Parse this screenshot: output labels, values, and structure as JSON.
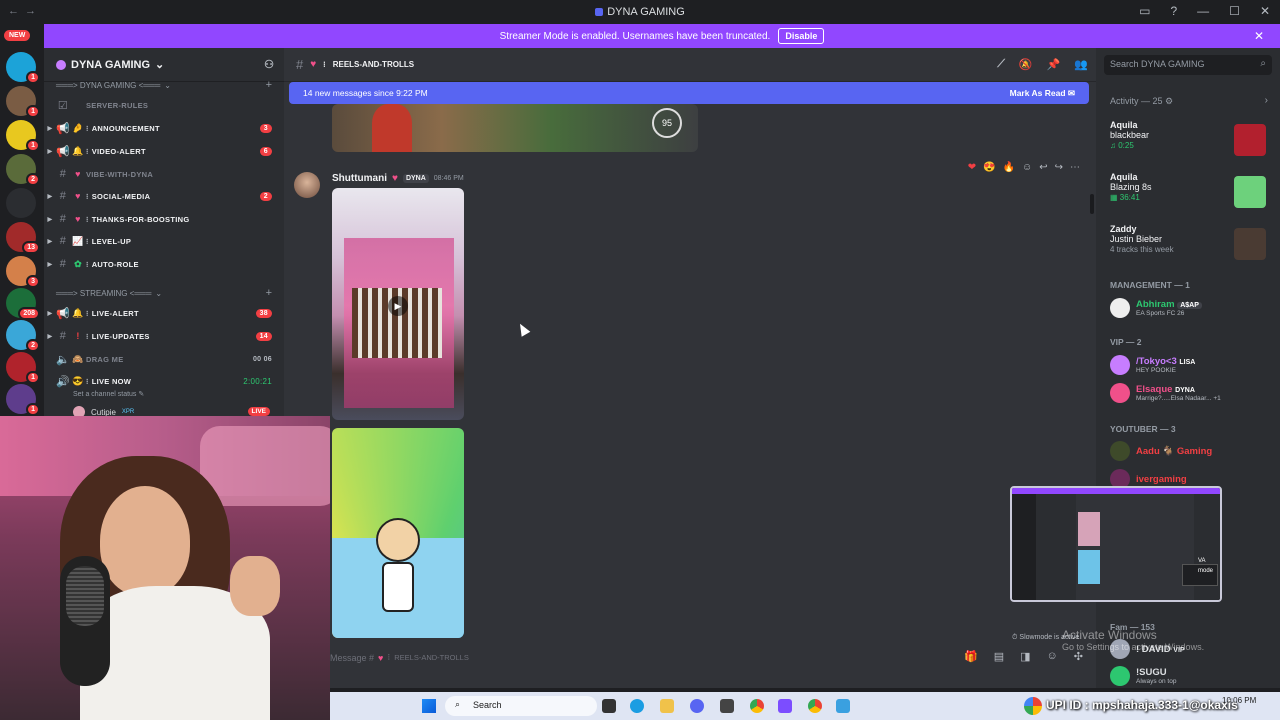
{
  "window": {
    "title": "DYNA GAMING"
  },
  "banner": {
    "text": "Streamer Mode is enabled. Usernames have been truncated.",
    "button": "Disable",
    "color": "#9147ff"
  },
  "rail": {
    "new_label": "NEW",
    "badges": [
      "1",
      "1",
      "1",
      "2",
      "13",
      "3",
      "208",
      "2",
      "1",
      "1"
    ]
  },
  "server": {
    "name": "DYNA GAMING",
    "category1": "═══> DYNA GAMING <═══",
    "category2": "═══> STREAMING <═══",
    "channels": [
      {
        "name": "SERVER-RULES",
        "muted": true
      },
      {
        "name": "ANNOUNCEMENT",
        "count": "3"
      },
      {
        "name": "VIDEO-ALERT",
        "count": "6"
      },
      {
        "name": "VIBE-WITH-DYNA",
        "muted": true
      },
      {
        "name": "SOCIAL-MEDIA",
        "count": "2"
      },
      {
        "name": "THANKS-FOR-BOOSTING"
      },
      {
        "name": "LEVEL-UP"
      },
      {
        "name": "AUTO-ROLE"
      }
    ],
    "stream_channels": [
      {
        "name": "LIVE-ALERT",
        "count": "38"
      },
      {
        "name": "LIVE-UPDATES",
        "count": "14"
      },
      {
        "name": "DRAG ME",
        "extra": "00  06",
        "muted": true
      },
      {
        "name": "LIVE NOW",
        "extra": "2:00:21"
      }
    ],
    "channel_status": "Set a channel status",
    "voice_user": "Cutipie",
    "voice_user_tag": "XPR",
    "live_badge": "LIVE"
  },
  "chat": {
    "channel": "REELS-AND-TROLLS",
    "new_messages": "14 new messages since 9:22 PM",
    "mark_as_read": "Mark As Read",
    "speed": "95",
    "author": "Shuttumani",
    "author_tag": "DYNA",
    "timestamp": "08:46 PM",
    "composer_placeholder": "Message #",
    "composer_channel": "REELS-AND-TROLLS",
    "slowmode": "Slowmode is active"
  },
  "members": {
    "search_placeholder": "Search DYNA GAMING",
    "activity_header": "Activity — 25",
    "activities": [
      {
        "name": "Aquila",
        "title": "blackbear",
        "detail": "0:25"
      },
      {
        "name": "Aquila",
        "title": "Blazing 8s",
        "detail": "36:41"
      },
      {
        "name": "Zaddy",
        "title": "Justin Bieber",
        "detail": "4 tracks this week"
      }
    ],
    "management_header": "MANAGEMENT — 1",
    "management": [
      {
        "name": "Abhiram",
        "tag": "A$AP",
        "status": "EA Sports FC 26",
        "color": "#2dc770"
      }
    ],
    "vip_header": "VIP — 2",
    "vip": [
      {
        "name": "/Tokyo<3",
        "tag": "LISA",
        "status": "HEY POOKIE",
        "color": "#c77dff"
      },
      {
        "name": "Elsaque",
        "tag": "DYNA",
        "status": "Marrige?.....Elsa Nadaar...",
        "extra": "+1",
        "color": "#f0508a"
      }
    ],
    "youtuber_header": "YOUTUBER — 3",
    "youtuber": [
      {
        "name": "Aadu",
        "suffix": "Gaming",
        "color": "#f23f43"
      },
      {
        "name": "ivergaming",
        "color": "#f23f43"
      }
    ],
    "fam_header": "Fam — 153",
    "fam": [
      {
        "name": "! DAVID",
        "tag": "VIP",
        "color": "#f2f3f5"
      },
      {
        "name": "!SUGU",
        "status": "Always on top",
        "color": "#f2f3f5"
      }
    ],
    "overflow_tag": "VA",
    "overflow_status": "mode"
  },
  "taskbar": {
    "search": "Search",
    "time": "10:06 PM"
  },
  "overlay": {
    "upi": "UPI ID : mpshahaja.333-1@okaxis",
    "activate_title": "Activate Windows",
    "activate_sub": "Go to Settings to activate Windows."
  }
}
